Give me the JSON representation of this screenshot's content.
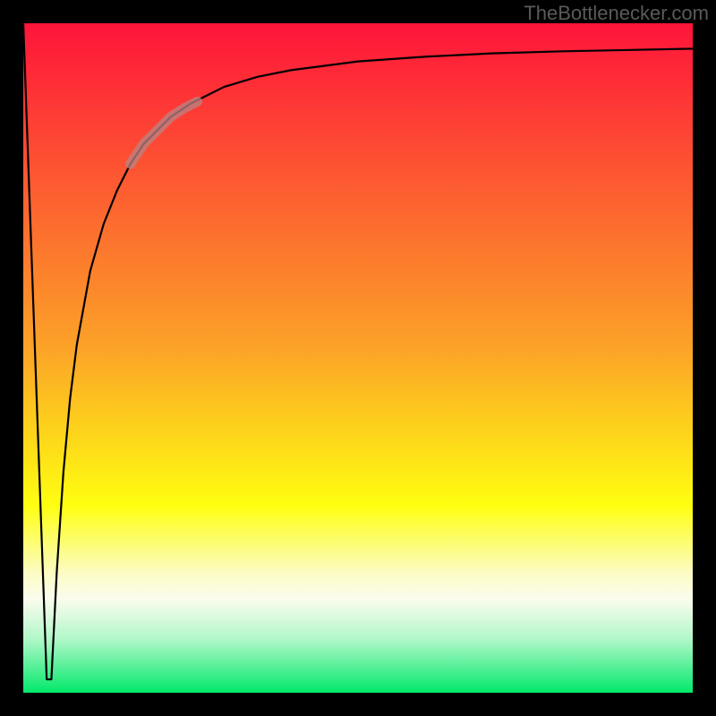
{
  "attribution": "TheBottlenecker.com",
  "chart_data": {
    "type": "line",
    "title": "",
    "xlabel": "",
    "ylabel": "",
    "xlim": [
      0,
      100
    ],
    "ylim": [
      0,
      100
    ],
    "series": [
      {
        "name": "left-spike",
        "x": [
          0,
          3.5,
          4.2
        ],
        "values": [
          100,
          2,
          2
        ]
      },
      {
        "name": "main-curve",
        "x": [
          4.2,
          5,
          6,
          7,
          8,
          10,
          12,
          14,
          16,
          18,
          20,
          22,
          25,
          30,
          35,
          40,
          50,
          60,
          70,
          80,
          90,
          100
        ],
        "values": [
          2,
          18,
          33,
          44,
          52,
          63,
          70,
          75,
          79,
          82,
          84,
          86,
          88,
          90.5,
          92,
          93,
          94.3,
          95,
          95.5,
          95.8,
          96.0,
          96.2
        ]
      },
      {
        "name": "highlight-segment",
        "x": [
          16,
          18,
          20,
          22,
          24,
          26
        ],
        "values": [
          79,
          82,
          84,
          86,
          87.3,
          88.3
        ]
      }
    ],
    "highlight_color": "#b98484",
    "gradient_stops": [
      {
        "offset": 0,
        "color": "#fe143a"
      },
      {
        "offset": 48,
        "color": "#fca128"
      },
      {
        "offset": 72,
        "color": "#fefe10"
      },
      {
        "offset": 82,
        "color": "#fcfcc2"
      },
      {
        "offset": 86,
        "color": "#fbfcee"
      },
      {
        "offset": 92,
        "color": "#b1f7c9"
      },
      {
        "offset": 100,
        "color": "#01e96a"
      }
    ],
    "frame_inset": 26,
    "frame_thickness": 26
  }
}
